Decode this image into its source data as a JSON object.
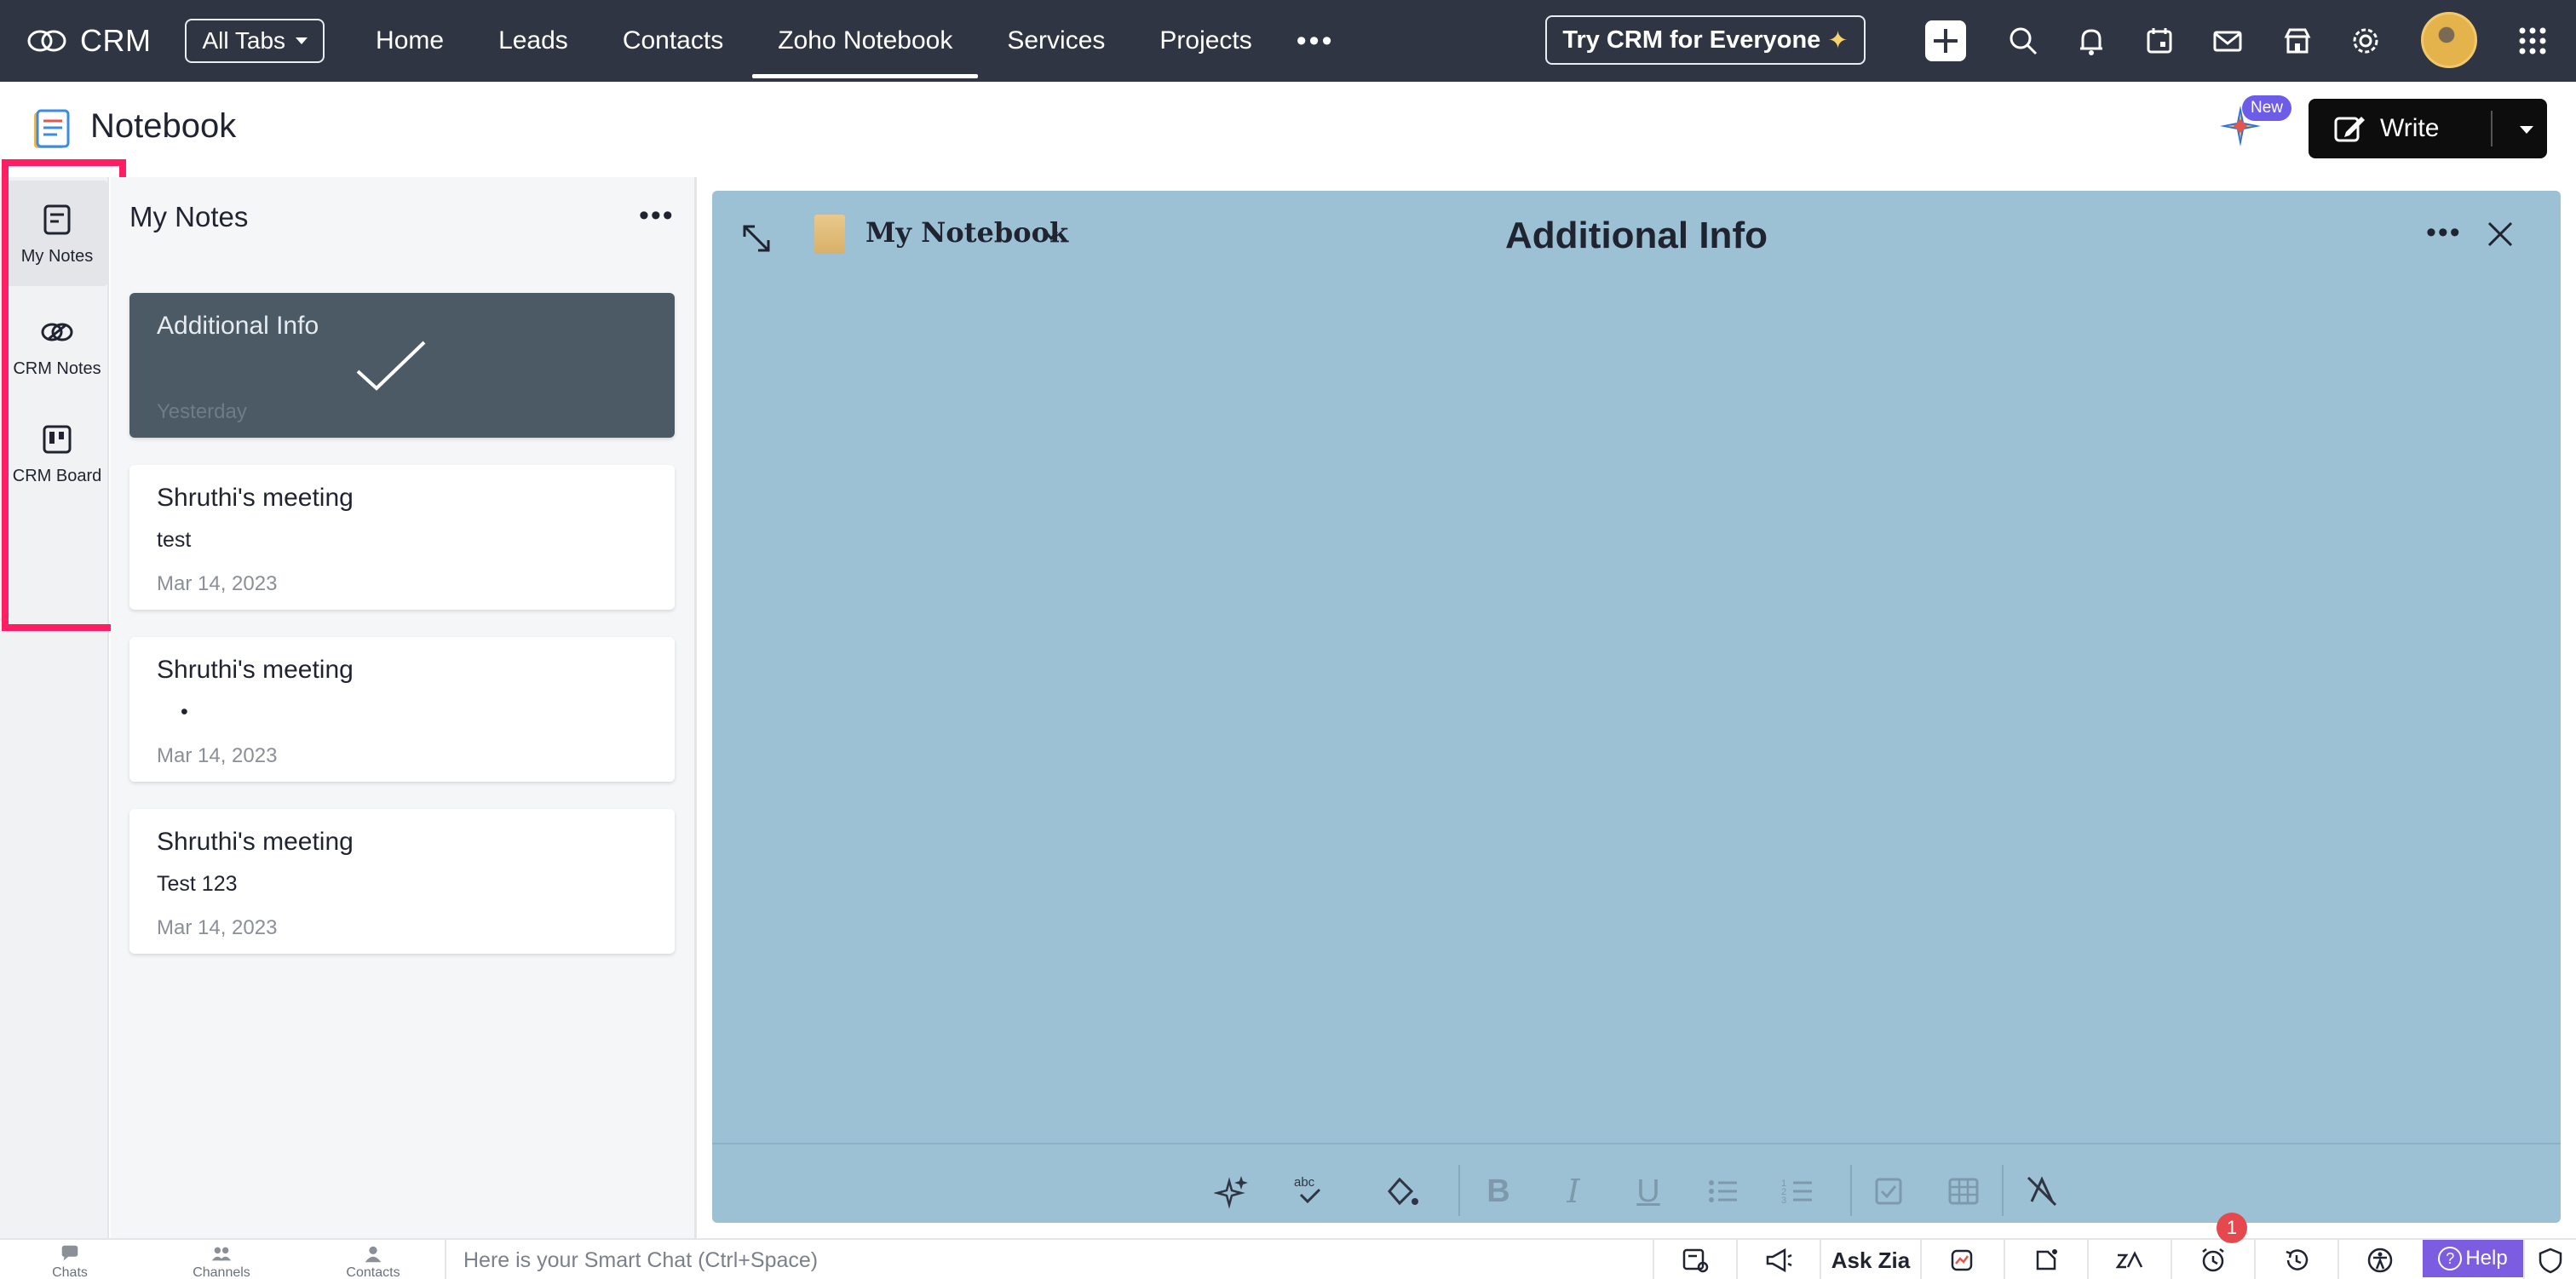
{
  "nav": {
    "logo_text": "CRM",
    "all_tabs": "All Tabs",
    "tabs": [
      {
        "label": "Home"
      },
      {
        "label": "Leads"
      },
      {
        "label": "Contacts"
      },
      {
        "label": "Zoho Notebook",
        "active": true
      },
      {
        "label": "Services"
      },
      {
        "label": "Projects"
      }
    ],
    "more": "•••",
    "try_crm": "Try CRM for Everyone",
    "try_crm_icon": "sparkle-icon",
    "icons": [
      "plus-icon",
      "search-icon",
      "bell-icon",
      "calendar-icon",
      "mail-icon",
      "marketplace-icon",
      "gear-icon",
      "avatar",
      "apps-grid-icon"
    ]
  },
  "header": {
    "title": "Notebook",
    "new_badge": "New",
    "write_label": "Write"
  },
  "rail": {
    "items": [
      {
        "label": "My Notes",
        "icon": "note-icon",
        "active": true
      },
      {
        "label": "CRM Notes",
        "icon": "link-rings-icon"
      },
      {
        "label": "CRM Board",
        "icon": "board-icon"
      }
    ],
    "highlight_color": "#ff1e63"
  },
  "list": {
    "title": "My Notes",
    "more": "•••",
    "notes": [
      {
        "title": "Additional Info",
        "snippet": "",
        "date": "Yesterday",
        "selected": true
      },
      {
        "title": "Shruthi's meeting",
        "snippet": "test",
        "date": "Mar 14, 2023"
      },
      {
        "title": "Shruthi's meeting",
        "snippet": "•",
        "date": "Mar 14, 2023"
      },
      {
        "title": "Shruthi's meeting",
        "snippet": "Test 123",
        "date": "Mar 14, 2023"
      }
    ]
  },
  "editor": {
    "notebook_name": "My Notebook",
    "title": "Additional Info",
    "more": "•••",
    "background": "#9dc1d4",
    "toolbar": [
      "zia-sparkle-icon",
      "spellcheck-icon",
      "fill-color-icon",
      "bold-icon",
      "italic-icon",
      "underline-icon",
      "bullet-list-icon",
      "numbered-list-icon",
      "checklist-icon",
      "table-icon",
      "clear-format-icon"
    ],
    "bold": "B",
    "italic": "I",
    "underline": "U",
    "spell": "abc"
  },
  "bottom": {
    "chats": "Chats",
    "channels": "Channels",
    "contacts": "Contacts",
    "smart_chat_placeholder": "Here is your Smart Chat (Ctrl+Space)",
    "ask_zia": "Ask Zia",
    "alarm_badge": "1",
    "help": "Help"
  }
}
